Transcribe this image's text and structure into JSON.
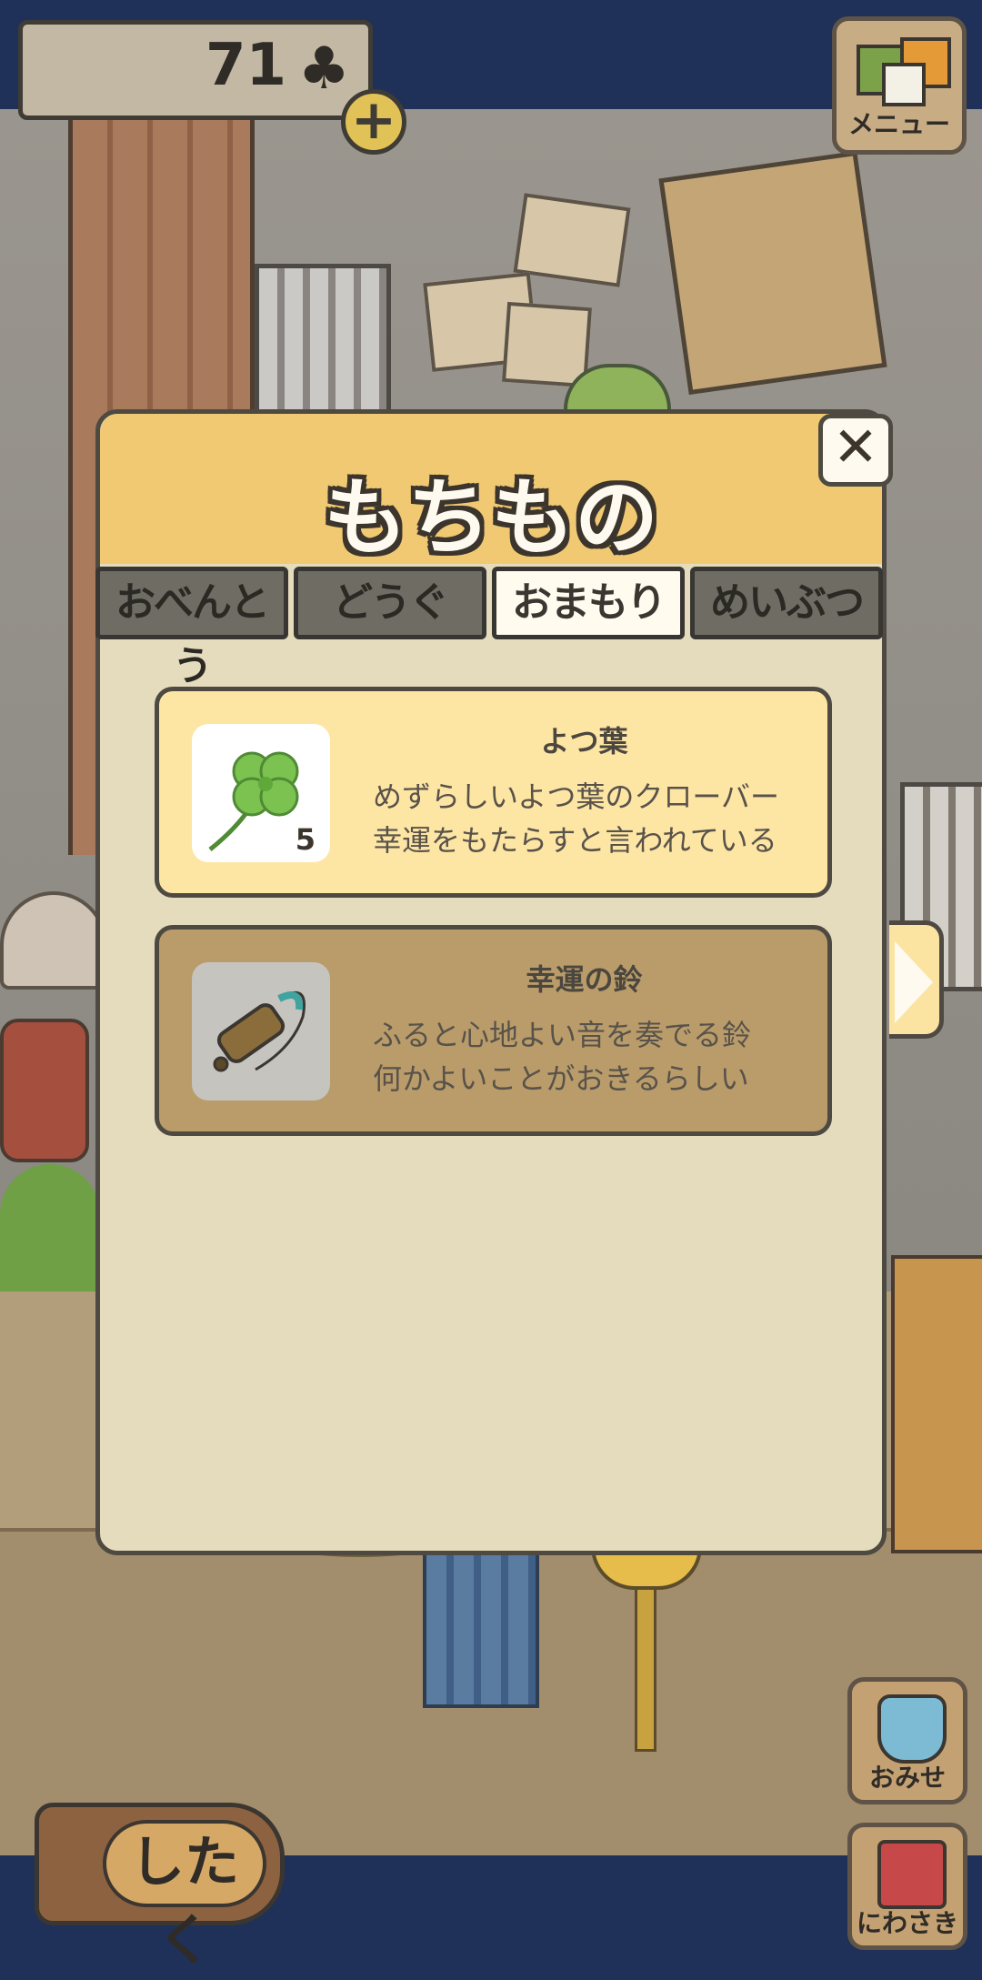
{
  "header": {
    "clover_count": "71",
    "clover_symbol": "♣",
    "plus_label": "+"
  },
  "menu_button": {
    "label": "メニュー"
  },
  "modal": {
    "title": "もちもの",
    "close_label": "✕",
    "tabs": [
      {
        "label": "おべんとう",
        "active": false
      },
      {
        "label": "どうぐ",
        "active": false
      },
      {
        "label": "おまもり",
        "active": true
      },
      {
        "label": "めいぶつ",
        "active": false
      }
    ],
    "items": [
      {
        "name": "よつ葉",
        "quantity": "5",
        "desc_line1": "めずらしいよつ葉のクローバー",
        "desc_line2": "幸運をもたらすと言われている",
        "icon": "four-leaf-clover-icon"
      },
      {
        "name": "幸運の鈴",
        "desc_line1": "ふると心地よい音を奏でる鈴",
        "desc_line2": "何かよいことがおきるらしい",
        "icon": "bell-icon"
      }
    ]
  },
  "bottom": {
    "shitaku_label": "したく",
    "shop_label": "おみせ",
    "garden_label": "にわさき"
  }
}
